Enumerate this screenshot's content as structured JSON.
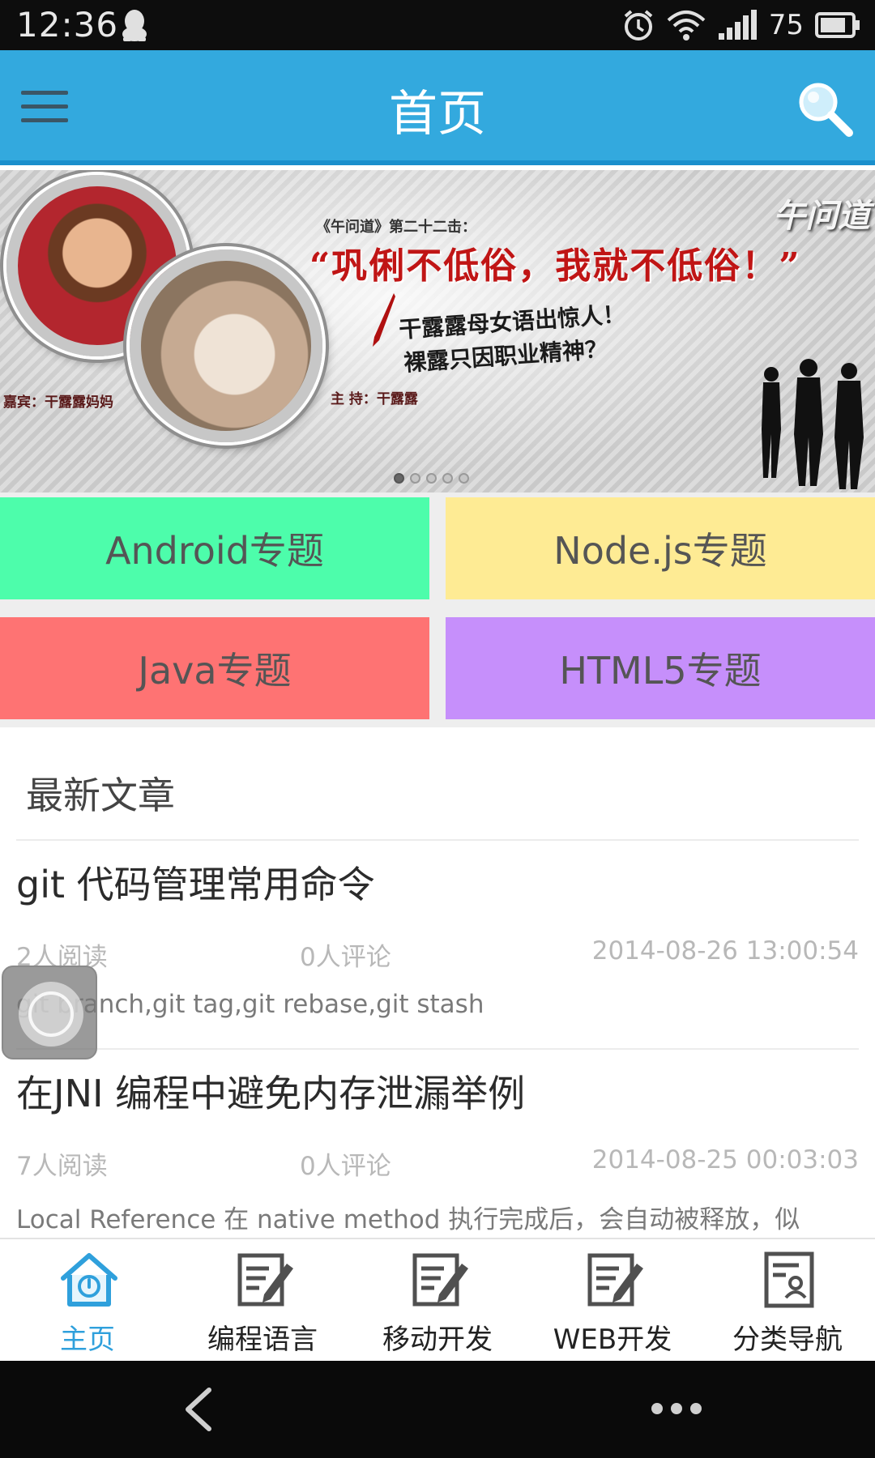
{
  "status_bar": {
    "time": "12:36",
    "battery": "75",
    "icons": [
      "qq-icon",
      "alarm-icon",
      "wifi-icon",
      "signal-icon",
      "battery-icon"
    ]
  },
  "header": {
    "title": "首页",
    "menu_icon": "menu-icon",
    "search_icon": "search-icon",
    "color": "#33a9de"
  },
  "banner": {
    "subtitle": "《午问道》第二十二击：",
    "quote": "“巩俐不低俗，我就不低俗！”",
    "line1": "干露露母女语出惊人！",
    "line2": "裸露只因职业精神？",
    "guest": "嘉宾：干露露妈妈",
    "host": "主 持：干露露",
    "logo": "午问道",
    "page_count": 5,
    "active_page": 0
  },
  "topics": [
    {
      "label": "Android专题",
      "color": "#4dfdab"
    },
    {
      "label": "Node.js专题",
      "color": "#feeb94"
    },
    {
      "label": "Java专题",
      "color": "#fe7373"
    },
    {
      "label": "HTML5专题",
      "color": "#c68ffb"
    }
  ],
  "latest": {
    "title": "最新文章",
    "articles": [
      {
        "title": "git 代码管理常用命令",
        "reads": "2人阅读",
        "comments": "0人评论",
        "date": "2014-08-26 13:00:54",
        "summary": "git branch,git tag,git rebase,git stash"
      },
      {
        "title": "在JNI 编程中避免内存泄漏举例",
        "reads": "7人阅读",
        "comments": "0人评论",
        "date": "2014-08-25 00:03:03",
        "summary": "Local Reference 在 native method 执行完成后，会自动被释放，似"
      }
    ]
  },
  "tabs": [
    {
      "label": "主页",
      "icon": "home-icon",
      "active": true
    },
    {
      "label": "编程语言",
      "icon": "edit-document-icon",
      "active": false
    },
    {
      "label": "移动开发",
      "icon": "edit-document-icon",
      "active": false
    },
    {
      "label": "WEB开发",
      "icon": "edit-document-icon",
      "active": false
    },
    {
      "label": "分类导航",
      "icon": "profile-document-icon",
      "active": false
    }
  ],
  "accent_color": "#2fa0dc"
}
